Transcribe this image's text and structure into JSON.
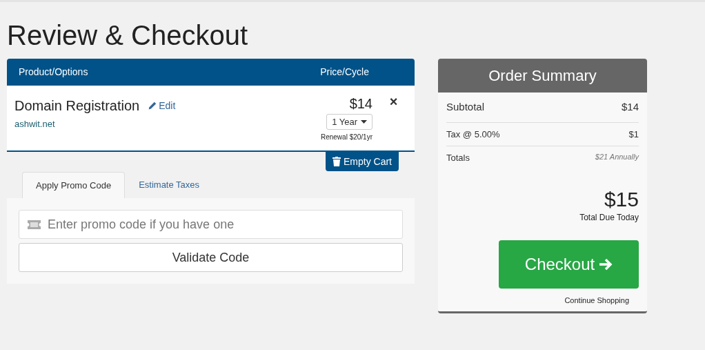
{
  "page_title": "Review & Checkout",
  "cart": {
    "columns": [
      "Product/Options",
      "Price/Cycle"
    ],
    "items": [
      {
        "name": "Domain Registration",
        "edit": "Edit",
        "domain": "ashwit.net",
        "price": "$14",
        "cycle": "1 Year",
        "renewal": "Renewal $20/1yr",
        "remove": "×"
      }
    ],
    "empty_cart": "Empty Cart"
  },
  "tabs": [
    {
      "label": "Apply Promo Code",
      "selected": true
    },
    {
      "label": "Estimate Taxes",
      "selected": false
    }
  ],
  "promo": {
    "placeholder": "Enter promo code if you have one",
    "button": "Validate Code"
  },
  "summary": {
    "title": "Order Summary",
    "rows": [
      {
        "kind": "main",
        "label": "Subtotal",
        "value": "$14"
      },
      {
        "kind": "line",
        "label": "Tax @ 5.00%",
        "value": "$1"
      },
      {
        "kind": "recurring",
        "label": "Totals",
        "value": "$21 Annually"
      }
    ],
    "total": "$15",
    "total_label": "Total Due Today",
    "checkout": "Checkout",
    "continue": "Continue Shopping"
  }
}
